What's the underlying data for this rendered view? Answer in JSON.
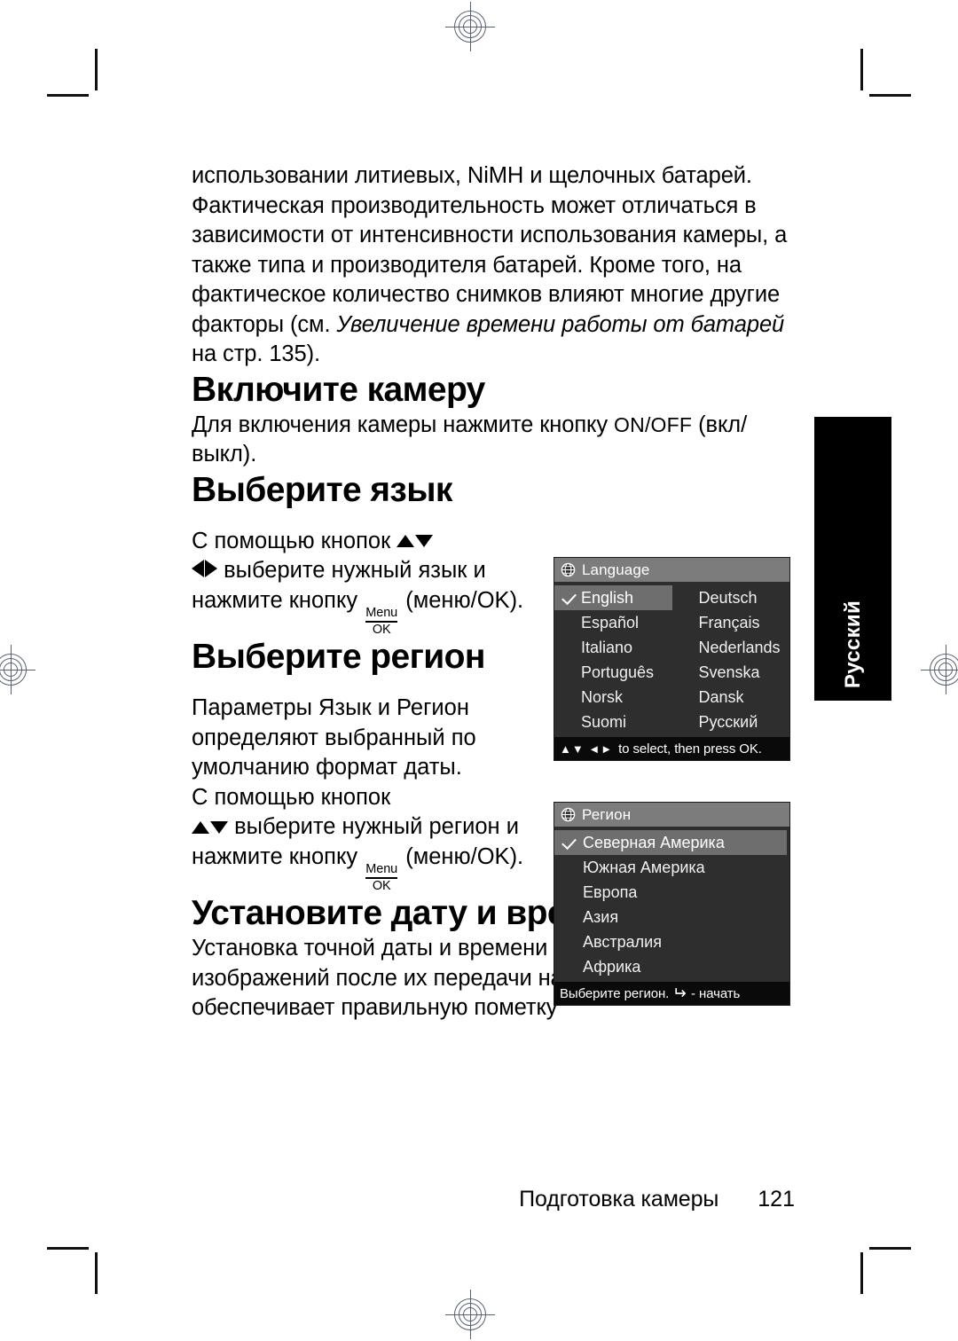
{
  "page": {
    "language_tab": "Русский",
    "footer_caption": "Подготовка камеры",
    "page_number": "121"
  },
  "intro": {
    "paragraph_before_italic": "использовании литиевых, NiMH и щелочных батарей. Фактическая производительность может отличаться в зависимости от интенсивности использования камеры, а также типа и производителя батарей. Кроме того, на фактическое количество снимков влияют многие другие факторы (см. ",
    "cross_reference_italic": "Увеличение времени работы от батарей",
    "paragraph_after_italic": " на стр. 135)."
  },
  "power_on": {
    "title": "Включите камеру",
    "text_before_button": "Для включения камеры нажмите кнопку ",
    "button_label": "ON/OFF",
    "text_after_button": " (вкл/выкл)."
  },
  "language": {
    "title": "Выберите язык",
    "instruction_line1": "С помощью кнопок ",
    "instruction_line2": " выберите нужный язык и нажмите кнопку ",
    "menu_ok_top": "Menu",
    "menu_ok_bottom": "OK",
    "instruction_line3": " (меню/OK).",
    "menu": {
      "title": "Language",
      "icon": "globe-icon",
      "column_left": [
        "English",
        "Español",
        "Italiano",
        "Português",
        "Norsk",
        "Suomi"
      ],
      "column_right": [
        "Deutsch",
        "Français",
        "Nederlands",
        "Svenska",
        "Dansk",
        "Русский"
      ],
      "selected": "English",
      "footer_arrows": "▲▼ ◄►",
      "footer_text": "to select, then press OK."
    }
  },
  "region": {
    "title": "Выберите регион",
    "paragraph": "Параметры Язык и Регион определяют выбранный по умолчанию формат даты.",
    "instruction_line1": "С помощью кнопок",
    "instruction_line2": " выберите нужный регион и нажмите кнопку ",
    "menu_ok_top": "Menu",
    "menu_ok_bottom": "OK",
    "instruction_line3": " (меню/OK).",
    "menu": {
      "title": "Регион",
      "icon": "globe-icon",
      "items": [
        "Северная Америка",
        "Южная Америка",
        "Европа",
        "Азия",
        "Австралия",
        "Африка"
      ],
      "selected": "Северная Америка",
      "footer_text_before": "Выберите регион.",
      "footer_back_glyph": "↵",
      "footer_text_after": "- начать"
    }
  },
  "datetime": {
    "title": "Установите дату и время",
    "paragraph": "Установка точной даты и времени облегчает поиск изображений после их передачи на компьютер, а также обеспечивает правильную пометку"
  }
}
